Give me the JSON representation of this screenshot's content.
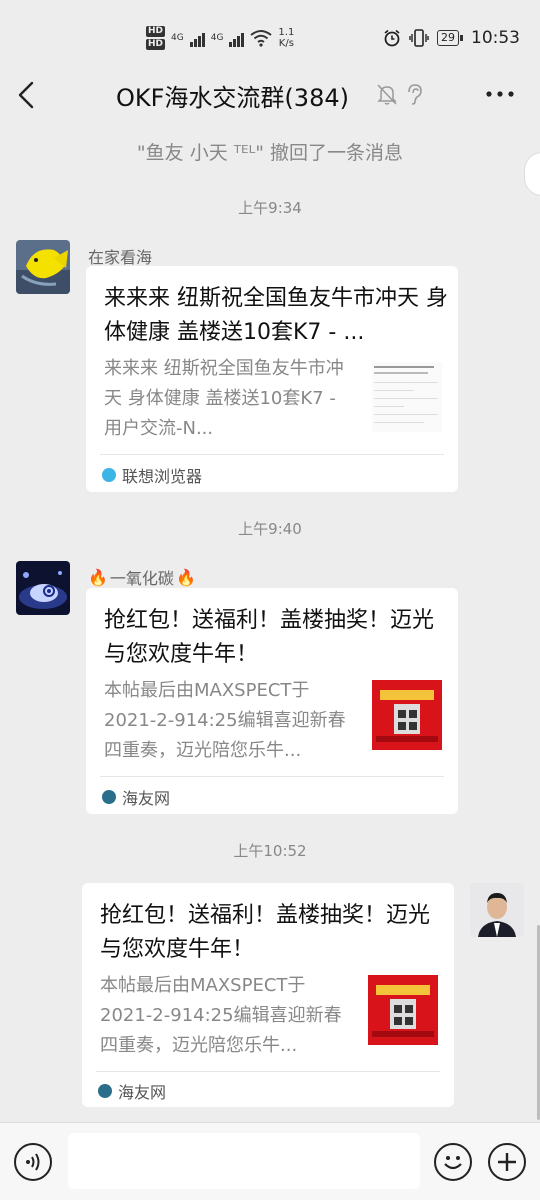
{
  "status_bar": {
    "hd1": "HD",
    "hd2": "HD",
    "net1": "4G",
    "net2": "4G",
    "speed_value": "1.1",
    "speed_unit": "K/s",
    "battery": "29",
    "time": "10:53"
  },
  "header": {
    "title": "OKF海水交流群(384)"
  },
  "recall_note": "\"鱼友 小天 ᵀᴱᴸ\" 撤回了一条消息",
  "messages": [
    {
      "time": "上午9:34",
      "sender": "在家看海",
      "title": "来来来 纽斯祝全国鱼友牛市冲天 身体健康 盖楼送10套K7 - ...",
      "desc": "来来来 纽斯祝全国鱼友牛市冲天 身体健康 盖楼送10套K7 - 用户交流-N...",
      "source": "联想浏览器",
      "source_color": "#3cb4e6"
    },
    {
      "time": "上午9:40",
      "sender_prefix": "🔥",
      "sender": "一氧化碳",
      "sender_suffix": "🔥",
      "title": "抢红包！送福利！盖楼抽奖！迈光与您欢度牛年！",
      "desc": "本帖最后由MAXSPECT于2021-2-914:25编辑喜迎新春四重奏，迈光陪您乐牛...",
      "source": "海友网",
      "source_color": "#2a6e8c"
    },
    {
      "time": "上午10:52",
      "title": "抢红包！送福利！盖楼抽奖！迈光与您欢度牛年！",
      "desc": "本帖最后由MAXSPECT于2021-2-914:25编辑喜迎新春四重奏，迈光陪您乐牛...",
      "source": "海友网",
      "source_color": "#2a6e8c"
    }
  ],
  "input": {
    "placeholder": ""
  }
}
